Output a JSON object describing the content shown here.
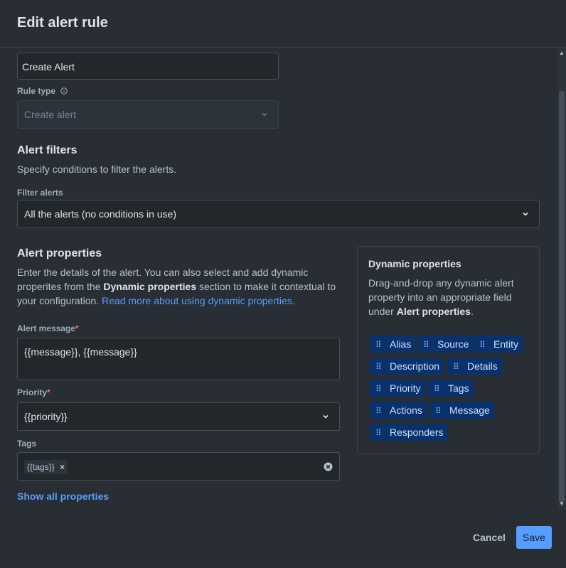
{
  "header": {
    "title": "Edit alert rule"
  },
  "form": {
    "rule_name_value": "Create Alert",
    "rule_type_label": "Rule type",
    "rule_type_value": "Create alert",
    "filters_title": "Alert filters",
    "filters_desc": "Specify conditions to filter the alerts.",
    "filter_label": "Filter alerts",
    "filter_value": "All the alerts (no conditions in use)",
    "props_title": "Alert properties",
    "props_desc_1": "Enter the details of the alert. You can also select and add dynamic",
    "props_desc_2a": "properites from the ",
    "props_desc_2b": "Dynamic properties",
    "props_desc_2c": " section to make it contextual to",
    "props_desc_3a": "your configuration. ",
    "props_desc_3b": "Read more about using dynamic properties.",
    "message_label": "Alert message",
    "message_value": "{{message}}, {{message}}",
    "priority_label": "Priority",
    "priority_value": "{{priority}}",
    "tags_label": "Tags",
    "tag_value": "{{tags}}",
    "show_all": "Show all properties",
    "required_mark": "*"
  },
  "dynamic": {
    "title": "Dynamic properties",
    "desc_1": "Drag-and-drop any dynamic alert",
    "desc_2": "property into an appropriate field",
    "desc_3a": "under ",
    "desc_3b": "Alert properties",
    "desc_3c": ".",
    "chips": [
      "Alias",
      "Source",
      "Entity",
      "Description",
      "Details",
      "Priority",
      "Tags",
      "Actions",
      "Message",
      "Responders"
    ]
  },
  "footer": {
    "cancel": "Cancel",
    "save": "Save"
  },
  "colors": {
    "accent": "#579dff",
    "chip_bg": "#09326c",
    "required": "#f87168"
  }
}
